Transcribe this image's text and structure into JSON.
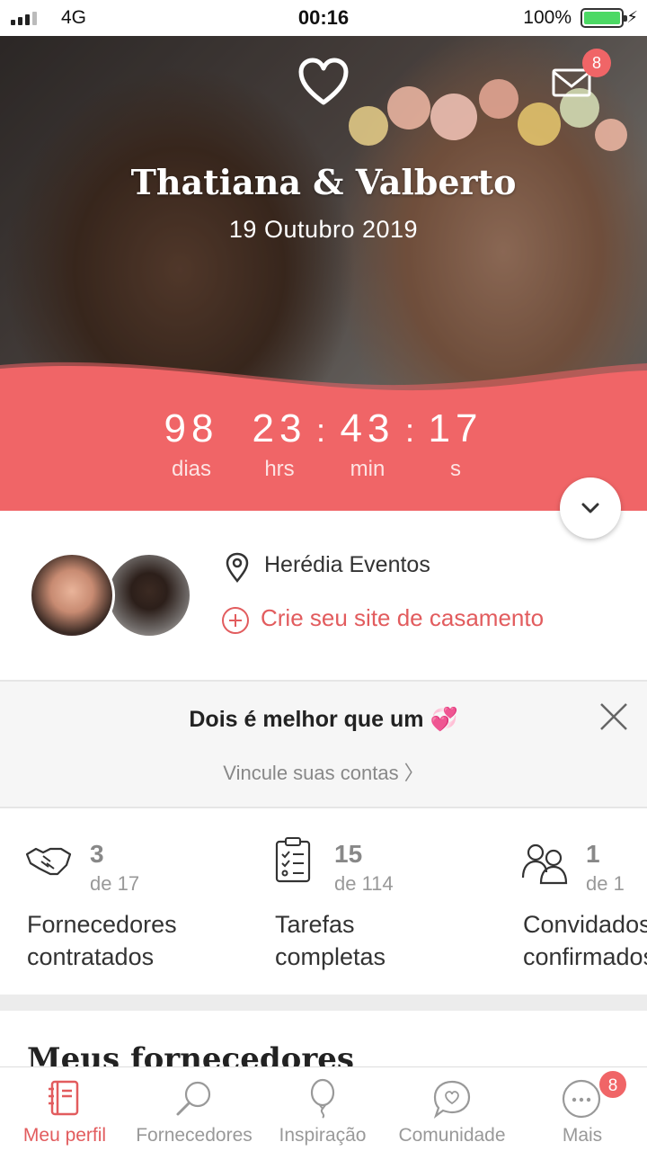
{
  "status_bar": {
    "carrier": "4G",
    "time": "00:16",
    "battery": "100%"
  },
  "hero": {
    "couple_names": "Thatiana & Valberto",
    "wedding_date": "19 Outubro 2019",
    "mail_badge": "8",
    "countdown": {
      "days": "98",
      "days_label": "dias",
      "hours": "23",
      "hours_label": "hrs",
      "minutes": "43",
      "minutes_label": "min",
      "seconds": "17",
      "seconds_label": "s",
      "separator": ":"
    }
  },
  "profile": {
    "venue": "Herédia Eventos",
    "create_site": "Crie seu site de casamento"
  },
  "link_accounts": {
    "title": "Dois é melhor que um 💞",
    "subtitle": "Vincule suas contas 〉"
  },
  "stats": [
    {
      "value": "3",
      "of": "de 17",
      "label_line1": "Fornecedores",
      "label_line2": "contratados"
    },
    {
      "value": "15",
      "of": "de 114",
      "label_line1": "Tarefas",
      "label_line2": "completas"
    },
    {
      "value": "1",
      "of": "de 1",
      "label_line1": "Convidados",
      "label_line2": "confirmados"
    }
  ],
  "section": {
    "title": "Meus fornecedores"
  },
  "tabbar": {
    "items": [
      {
        "label": "Meu perfil",
        "icon": "notebook-icon",
        "active": true
      },
      {
        "label": "Fornecedores",
        "icon": "search-icon",
        "active": false
      },
      {
        "label": "Inspiração",
        "icon": "balloon-icon",
        "active": false
      },
      {
        "label": "Comunidade",
        "icon": "chat-heart-icon",
        "active": false
      },
      {
        "label": "Mais",
        "icon": "more-icon",
        "active": false,
        "badge": "8"
      }
    ]
  },
  "colors": {
    "accent": "#f06567",
    "accent_text": "#e25c5e",
    "panel_bg": "#f6f6f6"
  }
}
